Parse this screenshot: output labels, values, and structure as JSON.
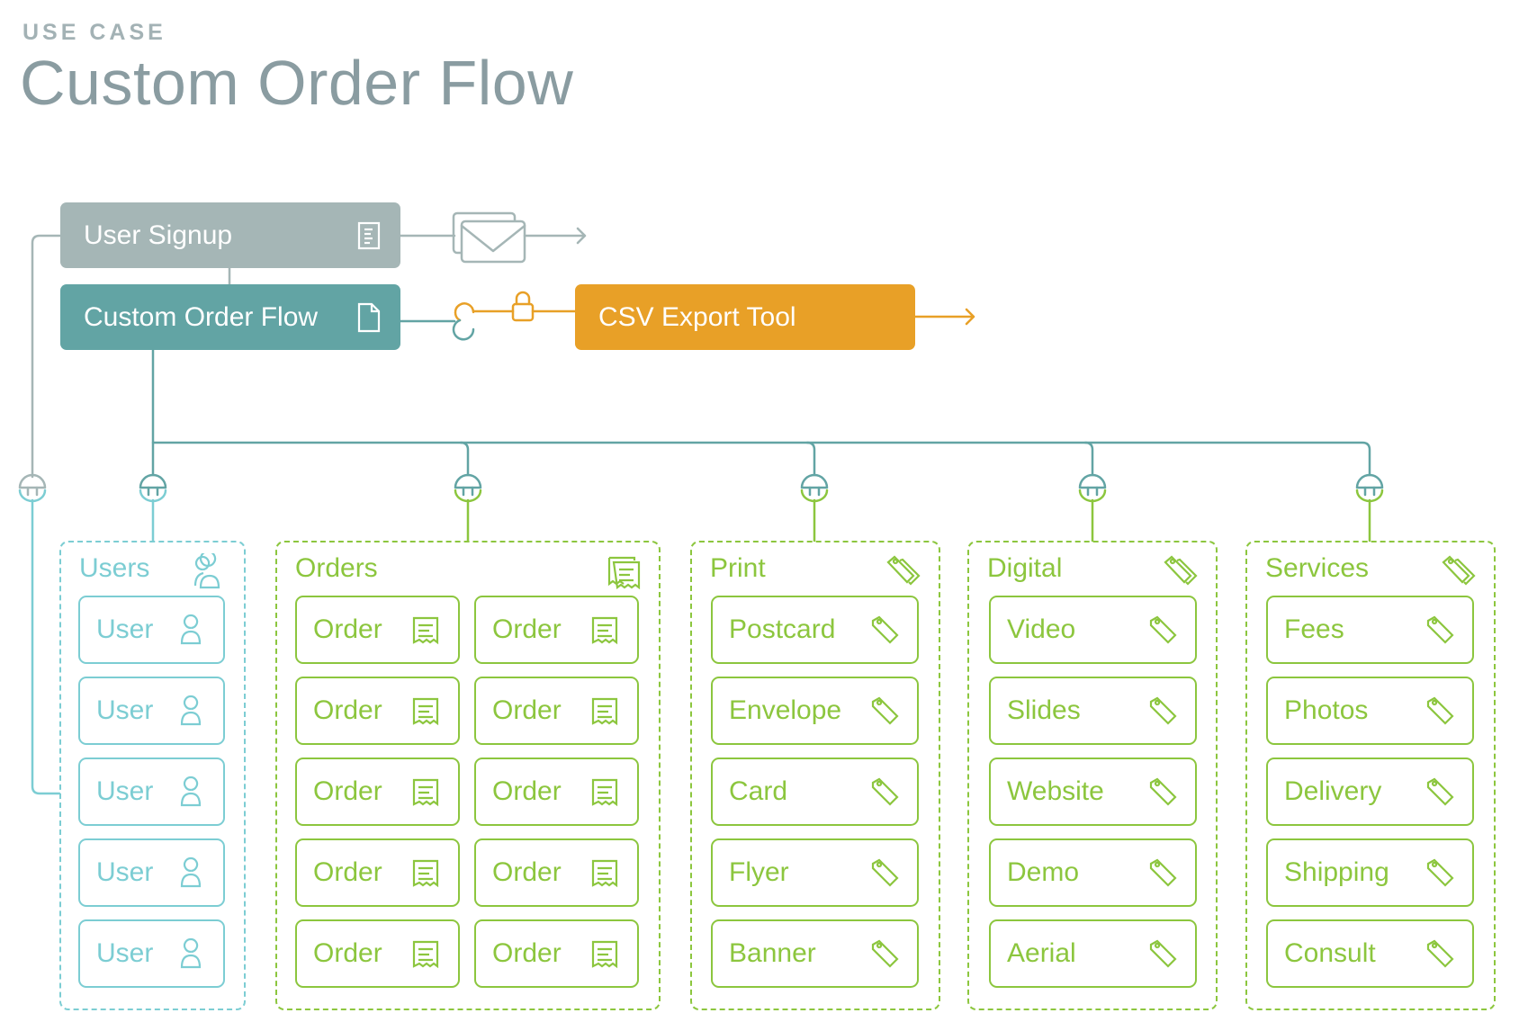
{
  "header": {
    "eyebrow": "USE CASE",
    "title": "Custom Order Flow"
  },
  "top_nodes": {
    "user_signup": {
      "label": "User Signup",
      "icon": "document-lines-icon"
    },
    "custom_order_flow": {
      "label": "Custom Order Flow",
      "icon": "document-icon"
    },
    "csv_export_tool": {
      "label": "CSV Export Tool"
    }
  },
  "connectors": {
    "signup_output": "envelope-icon",
    "csv_link": "link-icon",
    "csv_lock": "lock-icon",
    "group_plug": "plug-icon"
  },
  "colors": {
    "gray": "#a5b6b6",
    "teal": "#62a4a4",
    "orange": "#e8a027",
    "blue": "#7ccdd3",
    "green": "#8cc63e",
    "title": "#8a9ca1"
  },
  "groups": [
    {
      "title": "Users",
      "icon": "users-icon",
      "item_icon": "user-icon",
      "items": [
        "User",
        "User",
        "User",
        "User",
        "User"
      ]
    },
    {
      "title": "Orders",
      "icon": "receipts-icon",
      "item_icon": "receipt-icon",
      "items": [
        "Order",
        "Order",
        "Order",
        "Order",
        "Order",
        "Order",
        "Order",
        "Order",
        "Order",
        "Order"
      ]
    },
    {
      "title": "Print",
      "icon": "tags-icon",
      "item_icon": "tag-icon",
      "items": [
        "Postcard",
        "Envelope",
        "Card",
        "Flyer",
        "Banner"
      ]
    },
    {
      "title": "Digital",
      "icon": "tags-icon",
      "item_icon": "tag-icon",
      "items": [
        "Video",
        "Slides",
        "Website",
        "Demo",
        "Aerial"
      ]
    },
    {
      "title": "Services",
      "icon": "tags-icon",
      "item_icon": "tag-icon",
      "items": [
        "Fees",
        "Photos",
        "Delivery",
        "Shipping",
        "Consult"
      ]
    }
  ]
}
